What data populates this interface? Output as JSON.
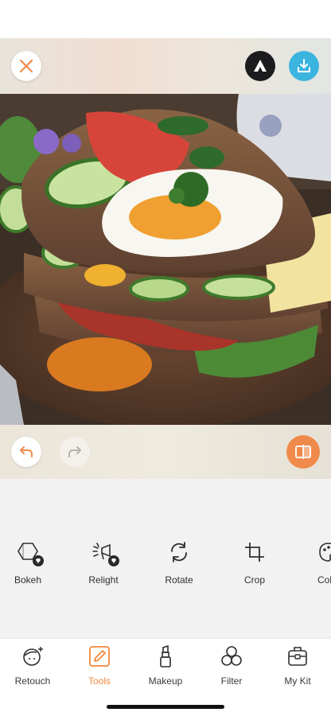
{
  "top_bar": {
    "close_icon": "close-icon",
    "brand_icon": "app-logo-icon",
    "download_icon": "download-icon",
    "accent": "#f08a4b",
    "download_color": "#3cb4e0"
  },
  "edit_bar": {
    "undo_icon": "undo-icon",
    "redo_icon": "redo-icon",
    "compare_icon": "compare-icon"
  },
  "tools": [
    {
      "label": "Bokeh",
      "icon": "bokeh-icon",
      "premium": true
    },
    {
      "label": "Relight",
      "icon": "relight-icon",
      "premium": true
    },
    {
      "label": "Rotate",
      "icon": "rotate-icon",
      "premium": false
    },
    {
      "label": "Crop",
      "icon": "crop-icon",
      "premium": false
    },
    {
      "label": "Col",
      "icon": "color-palette-icon",
      "premium": false
    }
  ],
  "bottom_nav": {
    "active": "Tools",
    "active_color": "#f0883e",
    "items": [
      {
        "label": "Retouch",
        "icon": "retouch-face-icon"
      },
      {
        "label": "Tools",
        "icon": "tools-pencil-icon"
      },
      {
        "label": "Makeup",
        "icon": "lipstick-icon"
      },
      {
        "label": "Filter",
        "icon": "filter-circles-icon"
      },
      {
        "label": "My Kit",
        "icon": "toolbox-icon"
      }
    ]
  }
}
